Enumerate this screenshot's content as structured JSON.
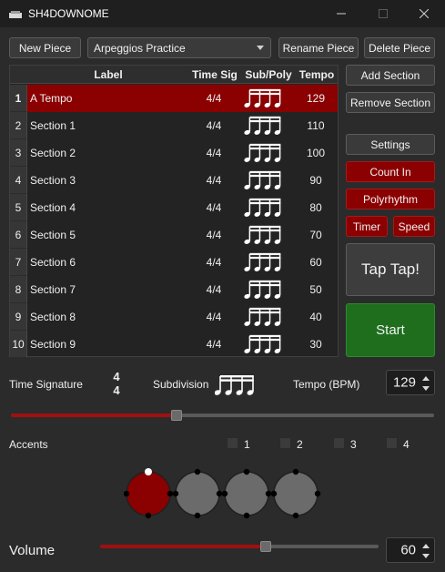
{
  "window": {
    "title": "SH4DOWNOME"
  },
  "toolbar": {
    "new_piece": "New Piece",
    "piece_selected": "Arpeggios Practice",
    "rename_piece": "Rename Piece",
    "delete_piece": "Delete Piece"
  },
  "table": {
    "headers": [
      "Label",
      "Time Sig",
      "Sub/Poly",
      "Tempo"
    ],
    "rows": [
      {
        "num": "1",
        "label": "A Tempo",
        "time_sig": "4/4",
        "tempo": "129"
      },
      {
        "num": "2",
        "label": "Section 1",
        "time_sig": "4/4",
        "tempo": "110"
      },
      {
        "num": "3",
        "label": "Section 2",
        "time_sig": "4/4",
        "tempo": "100"
      },
      {
        "num": "4",
        "label": "Section 3",
        "time_sig": "4/4",
        "tempo": "90"
      },
      {
        "num": "5",
        "label": "Section 4",
        "time_sig": "4/4",
        "tempo": "80"
      },
      {
        "num": "6",
        "label": "Section 5",
        "time_sig": "4/4",
        "tempo": "70"
      },
      {
        "num": "7",
        "label": "Section 6",
        "time_sig": "4/4",
        "tempo": "60"
      },
      {
        "num": "8",
        "label": "Section 7",
        "time_sig": "4/4",
        "tempo": "50"
      },
      {
        "num": "9",
        "label": "Section 8",
        "time_sig": "4/4",
        "tempo": "40"
      },
      {
        "num": "10",
        "label": "Section 9",
        "time_sig": "4/4",
        "tempo": "30"
      }
    ],
    "selected_row": 0
  },
  "side": {
    "add_section": "Add Section",
    "remove_section": "Remove Section",
    "settings": "Settings",
    "count_in": "Count In",
    "polyrhythm": "Polyrhythm",
    "timer": "Timer",
    "speed": "Speed",
    "tap": "Tap Tap!",
    "start": "Start"
  },
  "controls": {
    "time_signature_label": "Time Signature",
    "time_sig_top": "4",
    "time_sig_bottom": "4",
    "subdivision_label": "Subdivision",
    "tempo_label": "Tempo (BPM)",
    "tempo_value": "129",
    "tempo_slider_fraction": 0.39,
    "accents_label": "Accents",
    "accent_checks": [
      "1",
      "2",
      "3",
      "4"
    ],
    "accent_levels": [
      "accent",
      "normal",
      "normal",
      "normal"
    ],
    "volume_label": "Volume",
    "volume_value": "60",
    "volume_slider_fraction": 0.6
  },
  "colors": {
    "accent_red": "#8b0000",
    "start_green": "#1e6e1e",
    "background": "#2b2b2b"
  }
}
